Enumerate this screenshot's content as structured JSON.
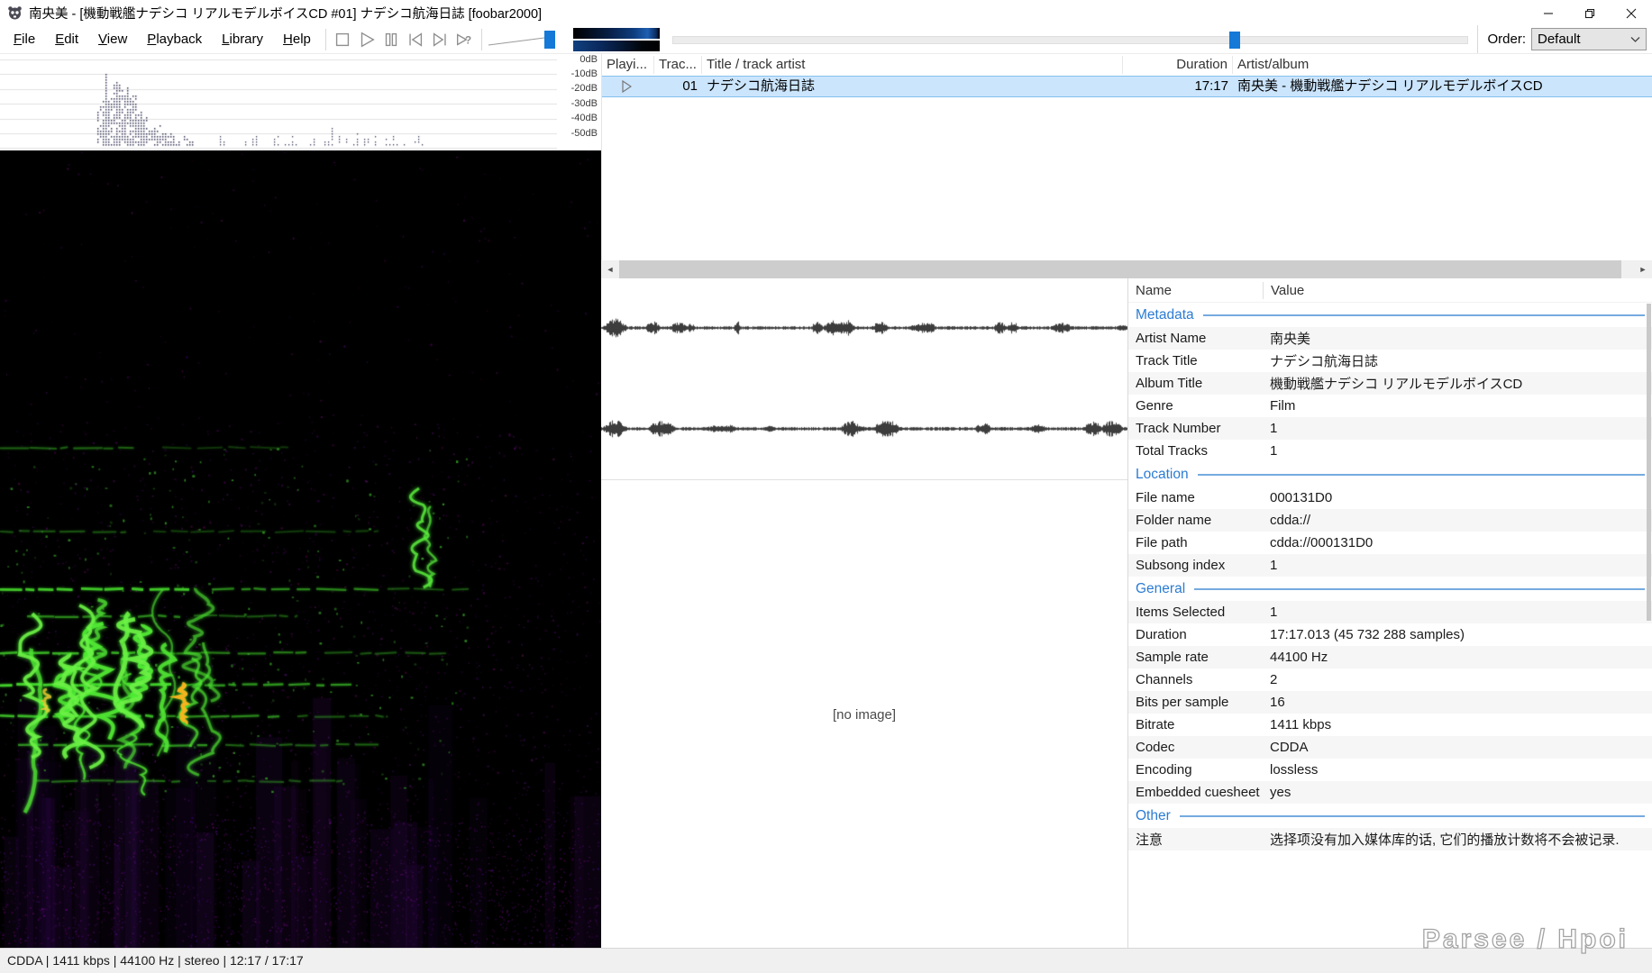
{
  "window": {
    "title": "南央美 - [機動戦艦ナデシコ リアルモデルボイスCD #01] ナデシコ航海日誌 [foobar2000]"
  },
  "menu": {
    "items": [
      "File",
      "Edit",
      "View",
      "Playback",
      "Library",
      "Help"
    ]
  },
  "toolbar": {
    "order_label": "Order:",
    "order_value": "Default"
  },
  "playlist": {
    "columns": [
      "Playi...",
      "Trac...",
      "Title / track artist",
      "Duration",
      "Artist/album"
    ],
    "rows": [
      {
        "playing": true,
        "track": "01",
        "title": "ナデシコ航海日誌",
        "duration": "17:17",
        "artist_album": "南央美 - 機動戦艦ナデシコ リアルモデルボイスCD"
      }
    ]
  },
  "analyzer": {
    "db_labels": [
      "0dB",
      "-10dB",
      "-20dB",
      "-30dB",
      "-40dB",
      "-50dB"
    ]
  },
  "album_art": {
    "placeholder": "[no image]"
  },
  "properties": {
    "columns": {
      "name": "Name",
      "value": "Value"
    },
    "sections": [
      {
        "title": "Metadata",
        "rows": [
          [
            "Artist Name",
            "南央美"
          ],
          [
            "Track Title",
            "ナデシコ航海日誌"
          ],
          [
            "Album Title",
            "機動戦艦ナデシコ リアルモデルボイスCD"
          ],
          [
            "Genre",
            "Film"
          ],
          [
            "Track Number",
            "1"
          ],
          [
            "Total Tracks",
            "1"
          ]
        ]
      },
      {
        "title": "Location",
        "rows": [
          [
            "File name",
            "000131D0"
          ],
          [
            "Folder name",
            "cdda://"
          ],
          [
            "File path",
            "cdda://000131D0"
          ],
          [
            "Subsong index",
            "1"
          ]
        ]
      },
      {
        "title": "General",
        "rows": [
          [
            "Items Selected",
            "1"
          ],
          [
            "Duration",
            "17:17.013 (45 732 288 samples)"
          ],
          [
            "Sample rate",
            "44100 Hz"
          ],
          [
            "Channels",
            "2"
          ],
          [
            "Bits per sample",
            "16"
          ],
          [
            "Bitrate",
            "1411 kbps"
          ],
          [
            "Codec",
            "CDDA"
          ],
          [
            "Encoding",
            "lossless"
          ],
          [
            "Embedded cuesheet",
            "yes"
          ]
        ]
      },
      {
        "title": "Other",
        "rows": [
          [
            "注意",
            "选择项没有加入媒体库的话, 它们的播放计数将不会被记录."
          ]
        ]
      }
    ]
  },
  "statusbar": {
    "text": "CDDA | 1411 kbps | 44100 Hz | stereo | 12:17 / 17:17"
  },
  "watermark": "Parsee / Hpoi"
}
